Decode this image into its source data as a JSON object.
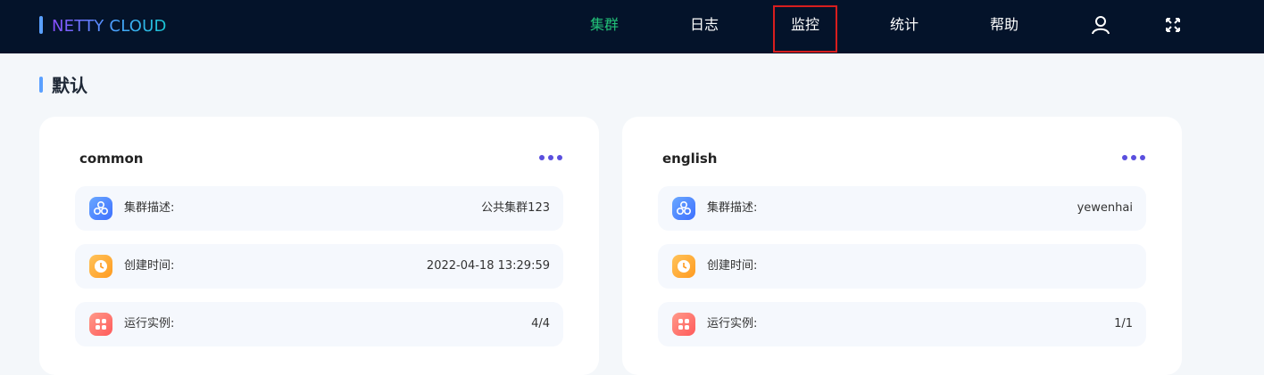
{
  "header": {
    "logo": "NETTY CLOUD",
    "nav": [
      {
        "label": "集群",
        "active": true
      },
      {
        "label": "日志"
      },
      {
        "label": "监控",
        "highlighted": true
      },
      {
        "label": "统计"
      },
      {
        "label": "帮助"
      }
    ],
    "icons": [
      "user-icon",
      "fullscreen-icon"
    ]
  },
  "section": {
    "title": "默认"
  },
  "cards": [
    {
      "name": "common",
      "rows": [
        {
          "icon": "cluster-icon",
          "label": "集群描述:",
          "value": "公共集群123"
        },
        {
          "icon": "clock-icon",
          "label": "创建时间:",
          "value": "2022-04-18 13:29:59"
        },
        {
          "icon": "instances-icon",
          "label": "运行实例:",
          "value": "4/4"
        }
      ]
    },
    {
      "name": "english",
      "rows": [
        {
          "icon": "cluster-icon",
          "label": "集群描述:",
          "value": "yewenhai"
        },
        {
          "icon": "clock-icon",
          "label": "创建时间:",
          "value": ""
        },
        {
          "icon": "instances-icon",
          "label": "运行实例:",
          "value": "1/1"
        }
      ]
    }
  ],
  "colors": {
    "topbar": "#04132a",
    "active_nav": "#22c178",
    "accent": "#5aa0ff",
    "more_dots": "#5a4fde"
  }
}
